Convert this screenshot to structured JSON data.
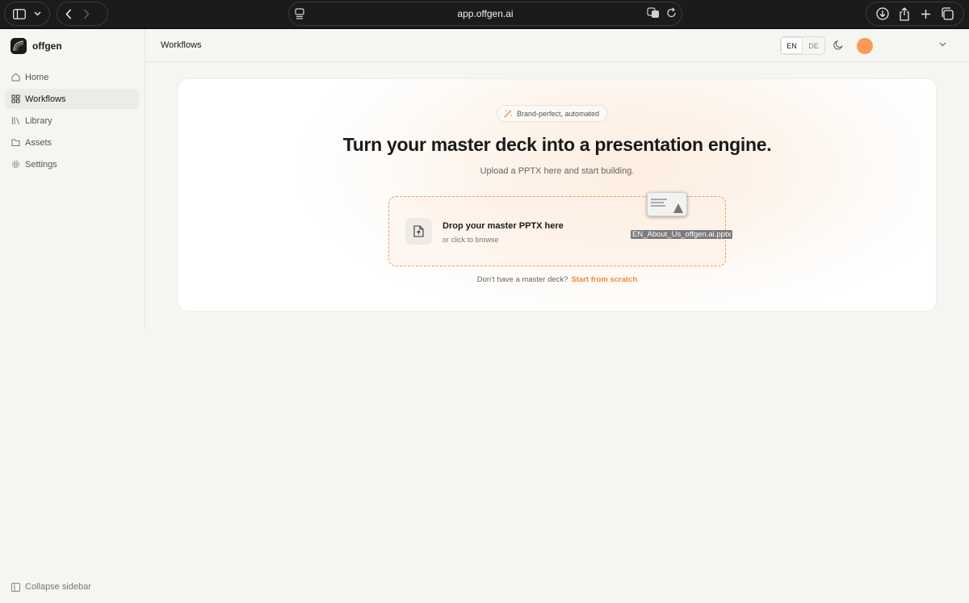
{
  "browser": {
    "url": "app.offgen.ai"
  },
  "sidebar": {
    "brand": "offgen",
    "items": [
      {
        "label": "Home",
        "icon": "home-icon"
      },
      {
        "label": "Workflows",
        "icon": "grid-icon",
        "active": true
      },
      {
        "label": "Library",
        "icon": "library-icon"
      },
      {
        "label": "Assets",
        "icon": "folder-icon"
      },
      {
        "label": "Settings",
        "icon": "gear-icon"
      }
    ],
    "collapse_label": "Collapse sidebar"
  },
  "header": {
    "title": "Workflows",
    "languages": [
      "EN",
      "DE"
    ],
    "active_language": "EN"
  },
  "hero": {
    "badge": "Brand-perfect, automated",
    "headline": "Turn your master deck into a presentation engine.",
    "subtitle": "Upload a PPTX here and start building.",
    "drop_title": "Drop your master PPTX here",
    "drop_subtitle": "or click to browse",
    "dragged_file": "EN_About_Us_offgen.ai.pptx",
    "footer_text": "Don't have a master deck?",
    "footer_link": "Start from scratch"
  },
  "colors": {
    "accent": "#f08a3c",
    "avatar": "#fb9a57",
    "background": "#f5f5f2"
  }
}
